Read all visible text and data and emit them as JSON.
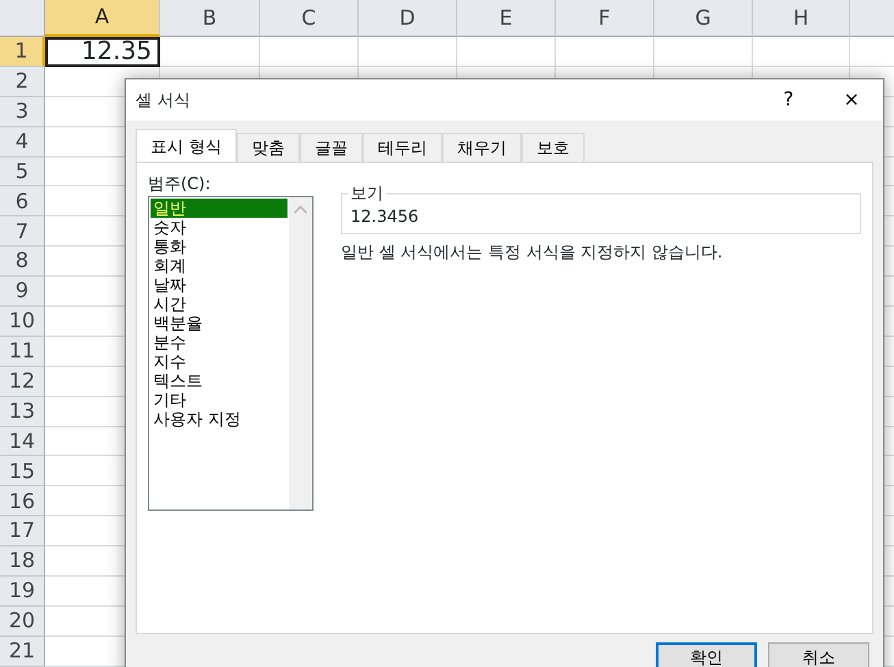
{
  "sheet": {
    "columns": [
      "A",
      "B",
      "C",
      "D",
      "E",
      "F",
      "G",
      "H"
    ],
    "rows": [
      "1",
      "2",
      "3",
      "4",
      "5",
      "6",
      "7",
      "8",
      "9",
      "10",
      "11",
      "12",
      "13",
      "14",
      "15",
      "16",
      "17",
      "18",
      "19",
      "20",
      "21"
    ],
    "active_cell": {
      "value": "12.35"
    }
  },
  "dialog": {
    "title": "셀 서식",
    "help": "?",
    "close": "×",
    "tabs": [
      {
        "label": "표시 형식",
        "selected": true
      },
      {
        "label": "맞춤",
        "selected": false
      },
      {
        "label": "글꼴",
        "selected": false
      },
      {
        "label": "테두리",
        "selected": false
      },
      {
        "label": "채우기",
        "selected": false
      },
      {
        "label": "보호",
        "selected": false
      }
    ],
    "category_label": "범주(C):",
    "categories": [
      {
        "label": "일반",
        "selected": true
      },
      {
        "label": "숫자",
        "selected": false
      },
      {
        "label": "통화",
        "selected": false
      },
      {
        "label": "회계",
        "selected": false
      },
      {
        "label": "날짜",
        "selected": false
      },
      {
        "label": "시간",
        "selected": false
      },
      {
        "label": "백분율",
        "selected": false
      },
      {
        "label": "분수",
        "selected": false
      },
      {
        "label": "지수",
        "selected": false
      },
      {
        "label": "텍스트",
        "selected": false
      },
      {
        "label": "기타",
        "selected": false
      },
      {
        "label": "사용자 지정",
        "selected": false
      }
    ],
    "sample": {
      "label": "보기",
      "value": "12.3456"
    },
    "description": "일반 셀 서식에서는 특정 서식을 지정하지 않습니다.",
    "buttons": [
      {
        "label": "확인",
        "default": true
      },
      {
        "label": "취소",
        "default": false
      }
    ]
  }
}
